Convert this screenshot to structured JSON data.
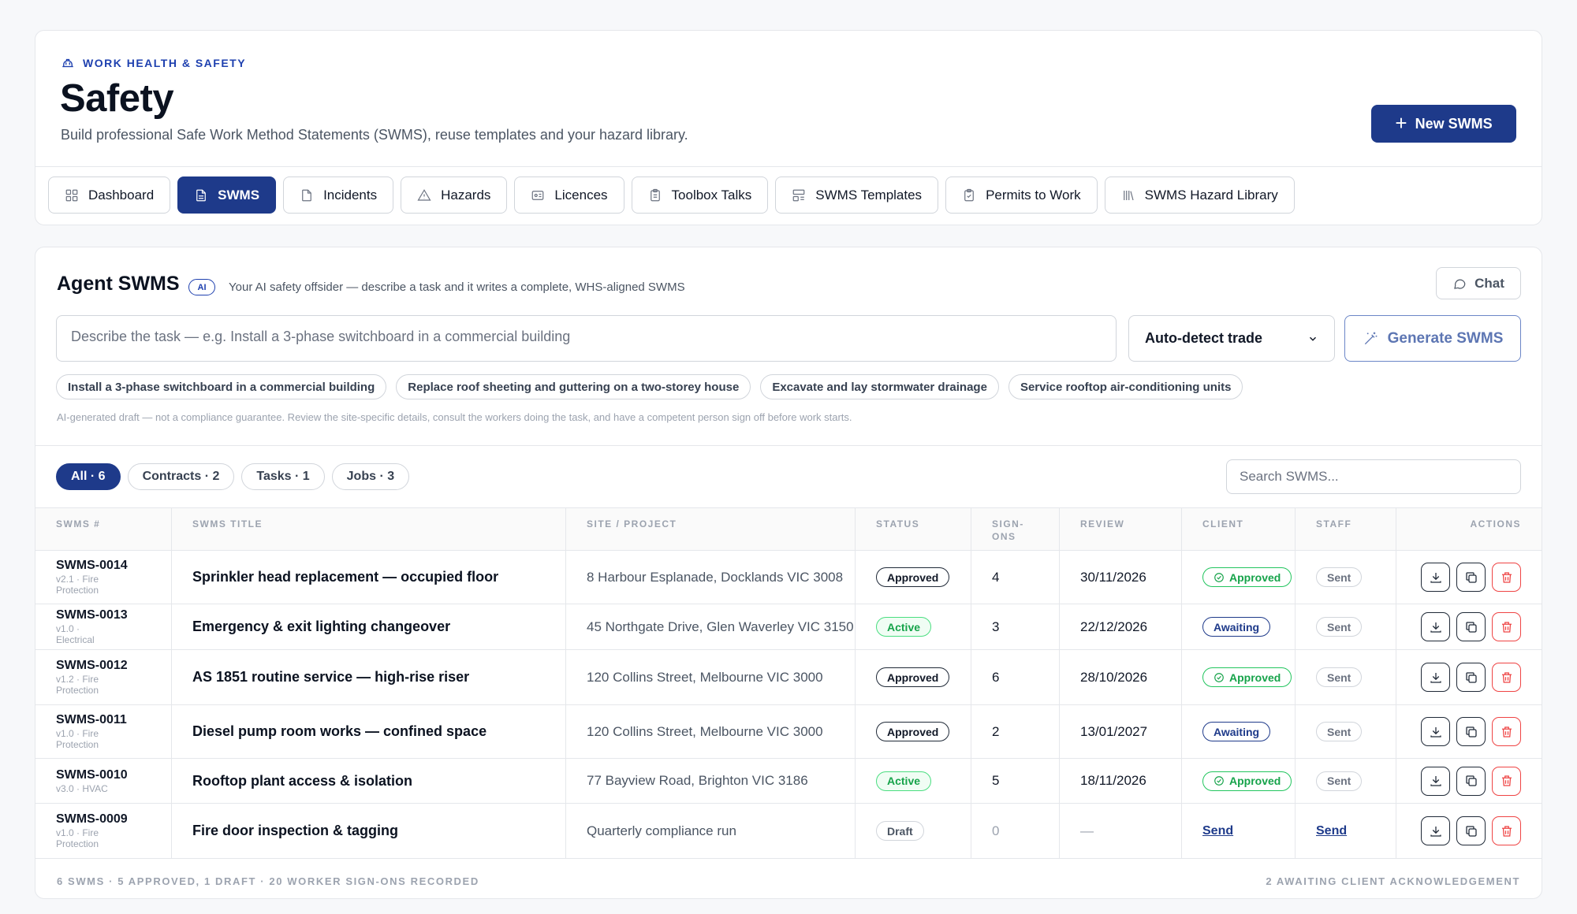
{
  "header": {
    "eyebrow": "WORK HEALTH & SAFETY",
    "title": "Safety",
    "subtitle": "Build professional Safe Work Method Statements (SWMS), reuse templates and your hazard library.",
    "new_button": "New SWMS"
  },
  "tabs": [
    {
      "label": "Dashboard",
      "icon": "grid-icon"
    },
    {
      "label": "SWMS",
      "icon": "document-icon",
      "active": true
    },
    {
      "label": "Incidents",
      "icon": "file-icon"
    },
    {
      "label": "Hazards",
      "icon": "warning-icon"
    },
    {
      "label": "Licences",
      "icon": "id-card-icon"
    },
    {
      "label": "Toolbox Talks",
      "icon": "clipboard-icon"
    },
    {
      "label": "SWMS Templates",
      "icon": "template-icon"
    },
    {
      "label": "Permits to Work",
      "icon": "clipboard-check-icon"
    },
    {
      "label": "SWMS Hazard Library",
      "icon": "library-icon"
    }
  ],
  "agent": {
    "title": "Agent SWMS",
    "badge": "AI",
    "subtitle": "Your AI safety offsider — describe a task and it writes a complete, WHS-aligned SWMS",
    "chat_button": "Chat",
    "input_placeholder": "Describe the task — e.g. Install a 3-phase switchboard in a commercial building",
    "trade_select": "Auto-detect trade",
    "generate_button": "Generate SWMS",
    "suggestions": [
      "Install a 3-phase switchboard in a commercial building",
      "Replace roof sheeting and guttering on a two-storey house",
      "Excavate and lay stormwater drainage",
      "Service rooftop air-conditioning units"
    ],
    "disclaimer": "AI-generated draft — not a compliance guarantee. Review the site-specific details, consult the workers doing the task, and have a competent person sign off before work starts."
  },
  "filters": [
    {
      "label": "All · 6",
      "active": true
    },
    {
      "label": "Contracts · 2"
    },
    {
      "label": "Tasks · 1"
    },
    {
      "label": "Jobs · 3"
    }
  ],
  "search": {
    "placeholder": "Search SWMS..."
  },
  "table": {
    "headers": [
      "SWMS #",
      "SWMS TITLE",
      "SITE / PROJECT",
      "STATUS",
      "SIGN-ONS",
      "REVIEW",
      "CLIENT",
      "STAFF",
      "ACTIONS"
    ],
    "rows": [
      {
        "id": "SWMS-0014",
        "meta": "v2.1 · Fire Protection",
        "title": "Sprinkler head replacement — occupied floor",
        "site": "8 Harbour Esplanade, Docklands VIC 3008",
        "status": "Approved",
        "signons": "4",
        "review": "30/11/2026",
        "client": "Approved",
        "staff": "Sent"
      },
      {
        "id": "SWMS-0013",
        "meta": "v1.0 · Electrical",
        "title": "Emergency & exit lighting changeover",
        "site": "45 Northgate Drive, Glen Waverley VIC 3150",
        "status": "Active",
        "signons": "3",
        "review": "22/12/2026",
        "client": "Awaiting",
        "staff": "Sent"
      },
      {
        "id": "SWMS-0012",
        "meta": "v1.2 · Fire Protection",
        "title": "AS 1851 routine service — high-rise riser",
        "site": "120 Collins Street, Melbourne VIC 3000",
        "status": "Approved",
        "signons": "6",
        "review": "28/10/2026",
        "client": "Approved",
        "staff": "Sent"
      },
      {
        "id": "SWMS-0011",
        "meta": "v1.0 · Fire Protection",
        "title": "Diesel pump room works — confined space",
        "site": "120 Collins Street, Melbourne VIC 3000",
        "status": "Approved",
        "signons": "2",
        "review": "13/01/2027",
        "client": "Awaiting",
        "staff": "Sent"
      },
      {
        "id": "SWMS-0010",
        "meta": "v3.0 · HVAC",
        "title": "Rooftop plant access & isolation",
        "site": "77 Bayview Road, Brighton VIC 3186",
        "status": "Active",
        "signons": "5",
        "review": "18/11/2026",
        "client": "Approved",
        "staff": "Sent"
      },
      {
        "id": "SWMS-0009",
        "meta": "v1.0 · Fire Protection",
        "title": "Fire door inspection & tagging",
        "site": "Quarterly compliance run",
        "status": "Draft",
        "signons": "0",
        "review": "—",
        "client": "Send",
        "staff": "Send"
      }
    ]
  },
  "footer": {
    "left": "6 SWMS · 5 APPROVED, 1 DRAFT · 20 WORKER SIGN-ONS RECORDED",
    "right": "2 AWAITING CLIENT ACKNOWLEDGEMENT"
  },
  "colors": {
    "primary": "#1e3a8a",
    "success": "#16a34a",
    "danger": "#ef4444"
  }
}
